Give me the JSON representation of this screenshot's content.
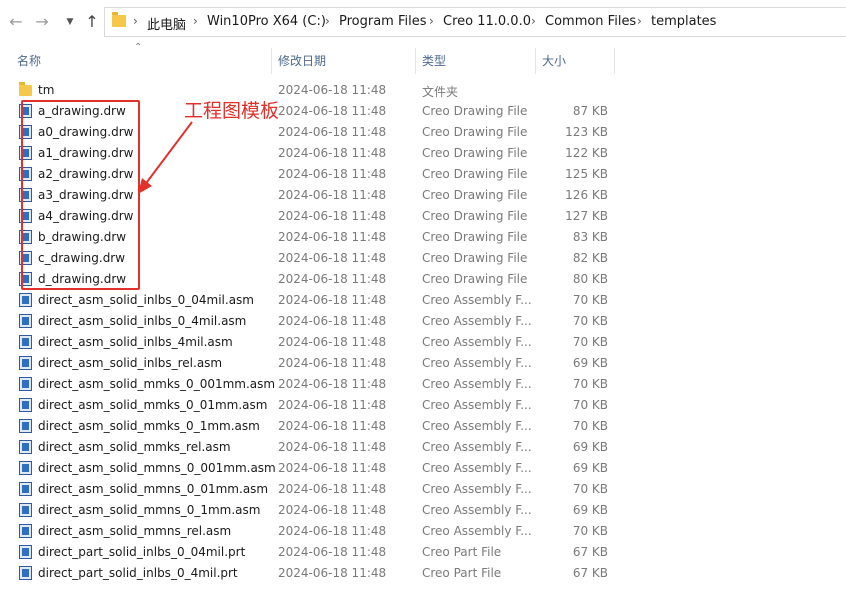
{
  "breadcrumbs": [
    "此电脑",
    "Win10Pro X64 (C:)",
    "Program Files",
    "Creo 11.0.0.0",
    "Common Files",
    "templates"
  ],
  "columns": {
    "name": "名称",
    "date": "修改日期",
    "type": "类型",
    "size": "大小"
  },
  "annotation": "工程图模板",
  "colors": {
    "accent_red": "#e0312b",
    "header_text": "#4d6a8a",
    "folder": "#f5c84a"
  },
  "rows": [
    {
      "name": "tm",
      "date": "2024-06-18 11:48",
      "type": "文件夹",
      "size": "",
      "icon": "folder-icon"
    },
    {
      "name": "a_drawing.drw",
      "date": "2024-06-18 11:48",
      "type": "Creo Drawing File",
      "size": "87 KB",
      "icon": "creo-file-icon"
    },
    {
      "name": "a0_drawing.drw",
      "date": "2024-06-18 11:48",
      "type": "Creo Drawing File",
      "size": "123 KB",
      "icon": "creo-file-icon"
    },
    {
      "name": "a1_drawing.drw",
      "date": "2024-06-18 11:48",
      "type": "Creo Drawing File",
      "size": "122 KB",
      "icon": "creo-file-icon"
    },
    {
      "name": "a2_drawing.drw",
      "date": "2024-06-18 11:48",
      "type": "Creo Drawing File",
      "size": "125 KB",
      "icon": "creo-file-icon"
    },
    {
      "name": "a3_drawing.drw",
      "date": "2024-06-18 11:48",
      "type": "Creo Drawing File",
      "size": "126 KB",
      "icon": "creo-file-icon"
    },
    {
      "name": "a4_drawing.drw",
      "date": "2024-06-18 11:48",
      "type": "Creo Drawing File",
      "size": "127 KB",
      "icon": "creo-file-icon"
    },
    {
      "name": "b_drawing.drw",
      "date": "2024-06-18 11:48",
      "type": "Creo Drawing File",
      "size": "83 KB",
      "icon": "creo-file-icon"
    },
    {
      "name": "c_drawing.drw",
      "date": "2024-06-18 11:48",
      "type": "Creo Drawing File",
      "size": "82 KB",
      "icon": "creo-file-icon"
    },
    {
      "name": "d_drawing.drw",
      "date": "2024-06-18 11:48",
      "type": "Creo Drawing File",
      "size": "80 KB",
      "icon": "creo-file-icon"
    },
    {
      "name": "direct_asm_solid_inlbs_0_04mil.asm",
      "date": "2024-06-18 11:48",
      "type": "Creo Assembly F...",
      "size": "70 KB",
      "icon": "creo-file-icon"
    },
    {
      "name": "direct_asm_solid_inlbs_0_4mil.asm",
      "date": "2024-06-18 11:48",
      "type": "Creo Assembly F...",
      "size": "70 KB",
      "icon": "creo-file-icon"
    },
    {
      "name": "direct_asm_solid_inlbs_4mil.asm",
      "date": "2024-06-18 11:48",
      "type": "Creo Assembly F...",
      "size": "70 KB",
      "icon": "creo-file-icon"
    },
    {
      "name": "direct_asm_solid_inlbs_rel.asm",
      "date": "2024-06-18 11:48",
      "type": "Creo Assembly F...",
      "size": "69 KB",
      "icon": "creo-file-icon"
    },
    {
      "name": "direct_asm_solid_mmks_0_001mm.asm",
      "date": "2024-06-18 11:48",
      "type": "Creo Assembly F...",
      "size": "70 KB",
      "icon": "creo-file-icon"
    },
    {
      "name": "direct_asm_solid_mmks_0_01mm.asm",
      "date": "2024-06-18 11:48",
      "type": "Creo Assembly F...",
      "size": "70 KB",
      "icon": "creo-file-icon"
    },
    {
      "name": "direct_asm_solid_mmks_0_1mm.asm",
      "date": "2024-06-18 11:48",
      "type": "Creo Assembly F...",
      "size": "70 KB",
      "icon": "creo-file-icon"
    },
    {
      "name": "direct_asm_solid_mmks_rel.asm",
      "date": "2024-06-18 11:48",
      "type": "Creo Assembly F...",
      "size": "69 KB",
      "icon": "creo-file-icon"
    },
    {
      "name": "direct_asm_solid_mmns_0_001mm.asm",
      "date": "2024-06-18 11:48",
      "type": "Creo Assembly F...",
      "size": "69 KB",
      "icon": "creo-file-icon"
    },
    {
      "name": "direct_asm_solid_mmns_0_01mm.asm",
      "date": "2024-06-18 11:48",
      "type": "Creo Assembly F...",
      "size": "70 KB",
      "icon": "creo-file-icon"
    },
    {
      "name": "direct_asm_solid_mmns_0_1mm.asm",
      "date": "2024-06-18 11:48",
      "type": "Creo Assembly F...",
      "size": "69 KB",
      "icon": "creo-file-icon"
    },
    {
      "name": "direct_asm_solid_mmns_rel.asm",
      "date": "2024-06-18 11:48",
      "type": "Creo Assembly F...",
      "size": "70 KB",
      "icon": "creo-file-icon"
    },
    {
      "name": "direct_part_solid_inlbs_0_04mil.prt",
      "date": "2024-06-18 11:48",
      "type": "Creo Part File",
      "size": "67 KB",
      "icon": "creo-file-icon"
    },
    {
      "name": "direct_part_solid_inlbs_0_4mil.prt",
      "date": "2024-06-18 11:48",
      "type": "Creo Part File",
      "size": "67 KB",
      "icon": "creo-file-icon"
    }
  ]
}
